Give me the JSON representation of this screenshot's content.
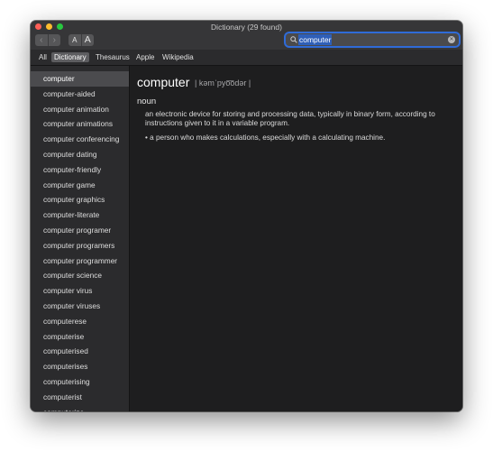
{
  "window": {
    "title": "Dictionary (29 found)"
  },
  "toolbar": {
    "back_label": "‹",
    "forward_label": "›",
    "font_smaller_label": "A",
    "font_larger_label": "A",
    "search_value": "computer"
  },
  "scopes": {
    "items": [
      {
        "label": "All"
      },
      {
        "label": "Dictionary"
      },
      {
        "label": "Thesaurus"
      },
      {
        "label": "Apple"
      },
      {
        "label": "Wikipedia"
      }
    ],
    "selected": "Dictionary"
  },
  "sidebar": {
    "items": [
      {
        "label": "computer"
      },
      {
        "label": "computer-aided"
      },
      {
        "label": "computer animation"
      },
      {
        "label": "computer animations"
      },
      {
        "label": "computer conferencing"
      },
      {
        "label": "computer dating"
      },
      {
        "label": "computer-friendly"
      },
      {
        "label": "computer game"
      },
      {
        "label": "computer graphics"
      },
      {
        "label": "computer-literate"
      },
      {
        "label": "computer programer"
      },
      {
        "label": "computer programers"
      },
      {
        "label": "computer programmer"
      },
      {
        "label": "computer science"
      },
      {
        "label": "computer virus"
      },
      {
        "label": "computer viruses"
      },
      {
        "label": "computerese"
      },
      {
        "label": "computerise"
      },
      {
        "label": "computerised"
      },
      {
        "label": "computerises"
      },
      {
        "label": "computerising"
      },
      {
        "label": "computerist"
      },
      {
        "label": "computerize"
      }
    ],
    "selected": "computer"
  },
  "entry": {
    "headword": "computer",
    "pronunciation": "| kəmˈpyo͞odər |",
    "part_of_speech": "noun",
    "definition_1": "an electronic device for storing and processing data, typically in binary form, according to instructions given to it in a variable program.",
    "definition_2": "• a person who makes calculations, especially with a calculating machine."
  },
  "colors": {
    "accent": "#2f6bd8",
    "window_bg": "#1e1e1f",
    "sidebar_bg": "#2b2b2d",
    "selection_bg": "#4b4b4e"
  }
}
